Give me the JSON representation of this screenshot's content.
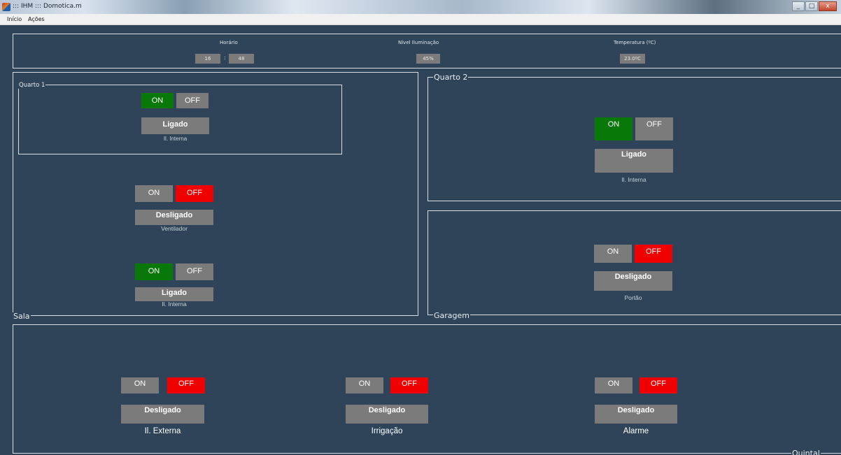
{
  "window": {
    "title": "::: IHM ::: Domotica.m",
    "minimize_label": "_",
    "maximize_label": "□",
    "close_label": "x"
  },
  "menu": {
    "items": [
      "Início",
      "Ações"
    ]
  },
  "status_panel": {
    "horario_label": "Horário",
    "hour": "16",
    "minute": "48",
    "iluminacao_label": "Nível Iluminação",
    "iluminacao_value": "45%",
    "temperatura_label": "Temperatura (ºC)",
    "temperatura_value": "23.0ºC"
  },
  "button_labels": {
    "on": "ON",
    "off": "OFF"
  },
  "panels": {
    "quarto1": {
      "title": "Quarto 1",
      "device": {
        "name": "Il. Interna",
        "state": "Ligado",
        "active": "on"
      }
    },
    "sala": {
      "title": "Sala",
      "devices": [
        {
          "name": "Ventilador",
          "state": "Desligado",
          "active": "off"
        },
        {
          "name": "Il. Interna",
          "state": "Ligado",
          "active": "on"
        }
      ]
    },
    "quarto2": {
      "title": "Quarto 2",
      "device": {
        "name": "Il. Interna",
        "state": "Ligado",
        "active": "on"
      }
    },
    "garagem": {
      "title": "Garagem",
      "device": {
        "name": "Portão",
        "state": "Desligado",
        "active": "off"
      }
    },
    "quintal": {
      "title": "Quintal",
      "devices": [
        {
          "name": "Il. Externa",
          "state": "Desligado",
          "active": "off"
        },
        {
          "name": "Irrigação",
          "state": "Desligado",
          "active": "off"
        },
        {
          "name": "Alarme",
          "state": "Desligado",
          "active": "off"
        }
      ]
    }
  },
  "colors": {
    "background": "#2f4458",
    "on_active": "#087808",
    "off_active": "#f00000",
    "inactive": "#7b7b7b",
    "border": "#d8dde3"
  }
}
